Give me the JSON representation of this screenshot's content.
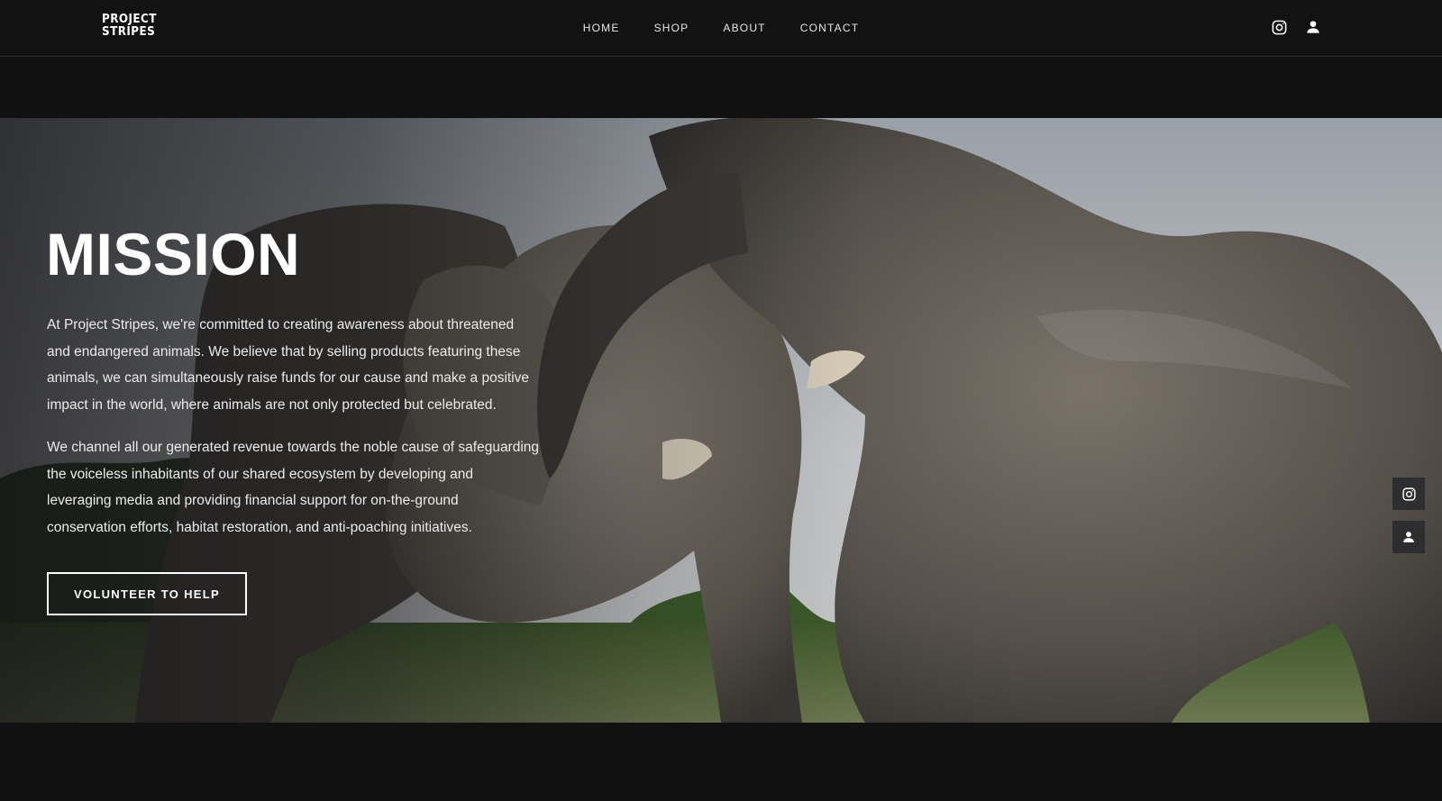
{
  "brand": {
    "line1": "PROJECT",
    "line2": "STRIPES"
  },
  "nav": {
    "items": [
      "HOME",
      "SHOP",
      "ABOUT",
      "CONTACT"
    ]
  },
  "header_icons": [
    "instagram-icon",
    "user-icon"
  ],
  "hero": {
    "title": "MISSION",
    "paragraph1": "At Project Stripes, we're committed to creating awareness about threatened and endangered animals. We believe that by selling products featuring these animals, we can simultaneously raise funds for our cause and make a positive impact in the world, where animals are not only protected but celebrated.",
    "paragraph2": "We channel all our generated revenue towards the noble cause of safeguarding the voiceless inhabitants of our shared ecosystem by developing and leveraging media and providing financial support for on-the-ground conservation efforts, habitat restoration, and anti-poaching initiatives.",
    "cta_label": "VOLUNTEER TO HELP"
  },
  "side_social": [
    "instagram-icon",
    "user-icon"
  ],
  "colors": {
    "background": "#111111",
    "text": "#ffffff"
  }
}
